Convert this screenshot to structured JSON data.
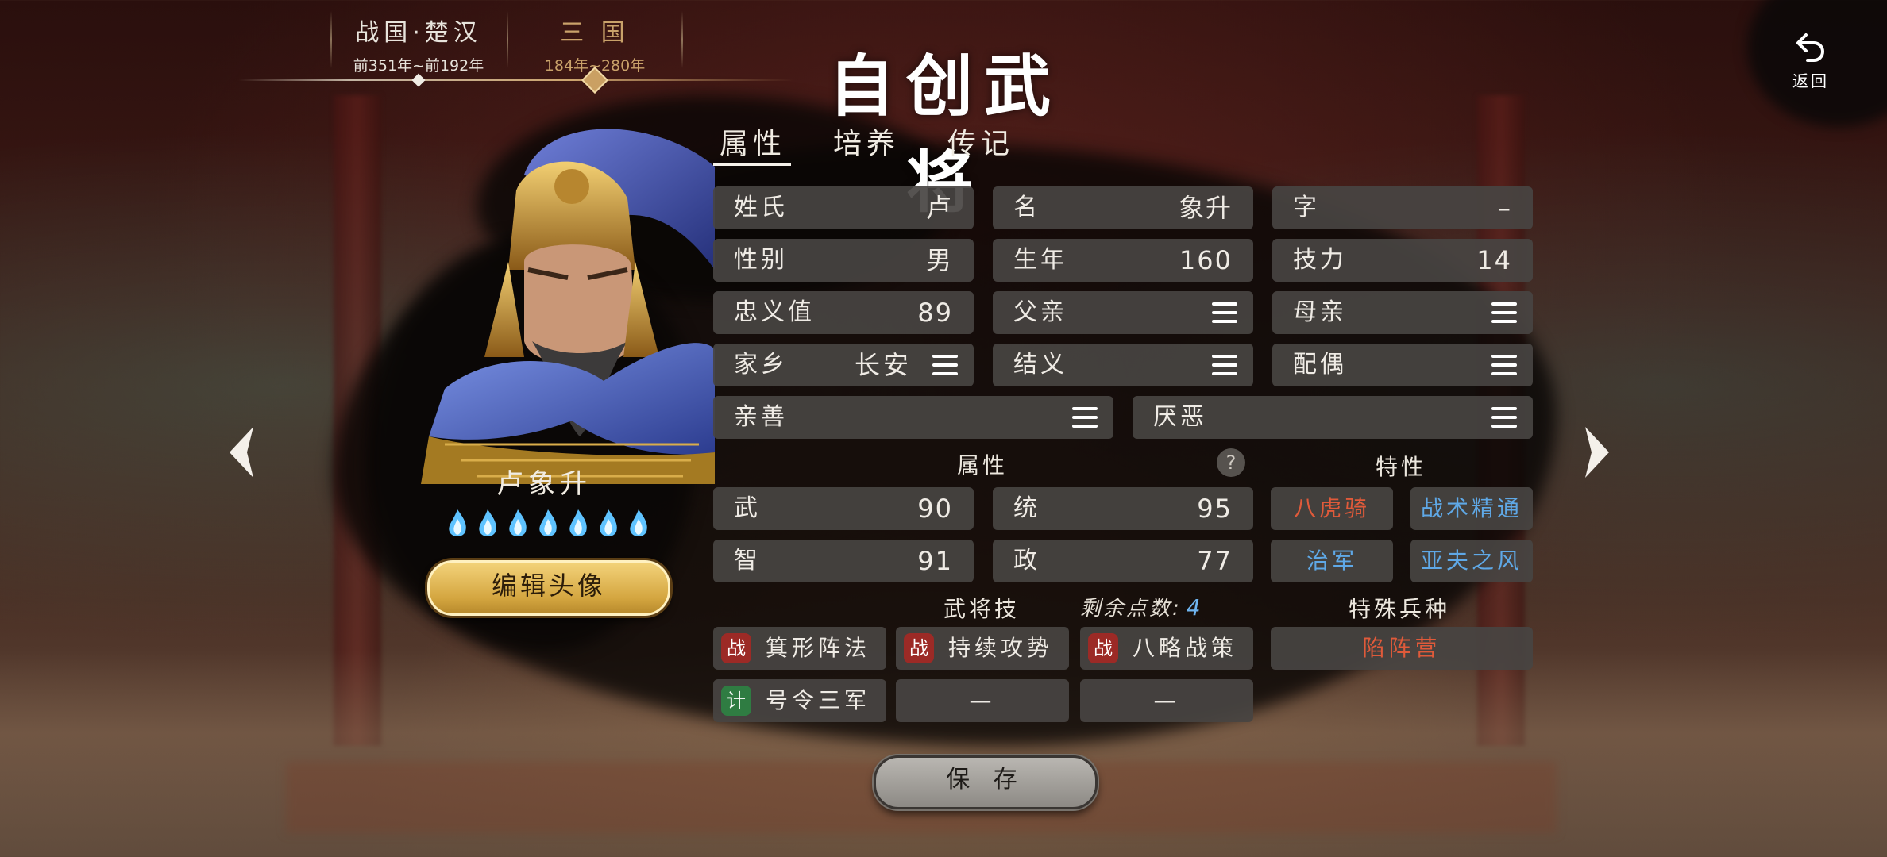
{
  "eras": [
    {
      "name": "战国·楚汉",
      "range": "前351年~前192年",
      "selected": false
    },
    {
      "name": "三 国",
      "range": "184年~280年",
      "selected": true
    }
  ],
  "page_title": "自创武将",
  "back": {
    "label": "返回",
    "icon": "back-arrow-icon"
  },
  "hero": {
    "name": "卢象升",
    "flame_count": 7,
    "edit_avatar_label": "编辑头像"
  },
  "tabs": [
    "属性",
    "培养",
    "传记"
  ],
  "active_tab": "属性",
  "fields": {
    "surname": {
      "label": "姓氏",
      "value": "卢"
    },
    "given_name": {
      "label": "名",
      "value": "象升"
    },
    "courtesy": {
      "label": "字",
      "value": "–"
    },
    "gender": {
      "label": "性别",
      "value": "男"
    },
    "birth_year": {
      "label": "生年",
      "value": "160"
    },
    "skill_power": {
      "label": "技力",
      "value": "14"
    },
    "loyalty": {
      "label": "忠义值",
      "value": "89"
    },
    "father": {
      "label": "父亲"
    },
    "mother": {
      "label": "母亲"
    },
    "hometown": {
      "label": "家乡",
      "value": "长安"
    },
    "sworn": {
      "label": "结义"
    },
    "spouse": {
      "label": "配偶"
    },
    "likes": {
      "label": "亲善"
    },
    "dislikes": {
      "label": "厌恶"
    }
  },
  "attributes": {
    "heading": "属性",
    "war": {
      "label": "武",
      "value": "90"
    },
    "lead": {
      "label": "统",
      "value": "95"
    },
    "intel": {
      "label": "智",
      "value": "91"
    },
    "politics": {
      "label": "政",
      "value": "77"
    }
  },
  "traits": {
    "heading": "特性",
    "items": [
      {
        "label": "八虎骑",
        "color": "#e05a3a"
      },
      {
        "label": "战术精通",
        "color": "#5fa8e6"
      },
      {
        "label": "治军",
        "color": "#5fa8e6"
      },
      {
        "label": "亚夫之风",
        "color": "#5fa8e6"
      }
    ]
  },
  "skills": {
    "heading": "武将技",
    "remaining_label": "剩余点数:",
    "remaining_value": "4",
    "items": [
      {
        "badge": "战",
        "name": "箕形阵法"
      },
      {
        "badge": "战",
        "name": "持续攻势"
      },
      {
        "badge": "战",
        "name": "八略战策"
      },
      {
        "badge": "计",
        "name": "号令三军"
      },
      {
        "empty": "—"
      },
      {
        "empty": "—"
      }
    ]
  },
  "special_unit": {
    "heading": "特殊兵种",
    "value": "陷阵营"
  },
  "save_label": "保 存",
  "colors": {
    "gold": "#caa063",
    "red_text": "#e05a3a",
    "blue_text": "#5fa8e6",
    "cell_bg": "#484442"
  }
}
